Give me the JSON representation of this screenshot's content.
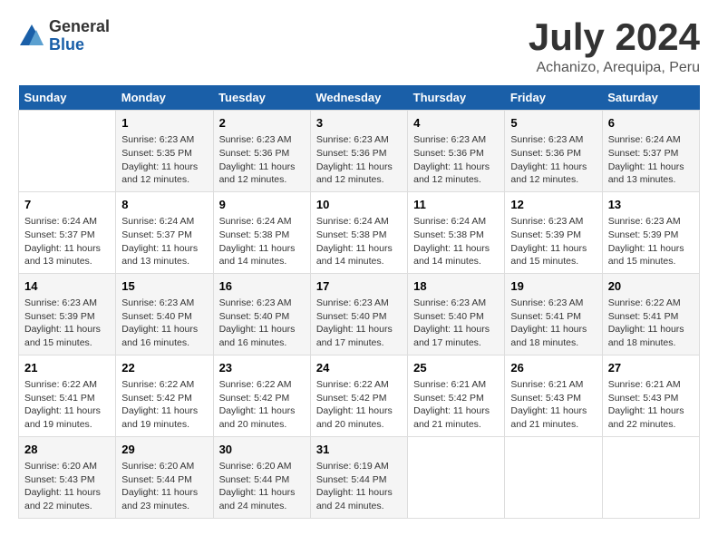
{
  "logo": {
    "general": "General",
    "blue": "Blue"
  },
  "title": "July 2024",
  "subtitle": "Achanizo, Arequipa, Peru",
  "weekdays": [
    "Sunday",
    "Monday",
    "Tuesday",
    "Wednesday",
    "Thursday",
    "Friday",
    "Saturday"
  ],
  "weeks": [
    [
      {
        "day": "",
        "text": ""
      },
      {
        "day": "1",
        "text": "Sunrise: 6:23 AM\nSunset: 5:35 PM\nDaylight: 11 hours\nand 12 minutes."
      },
      {
        "day": "2",
        "text": "Sunrise: 6:23 AM\nSunset: 5:36 PM\nDaylight: 11 hours\nand 12 minutes."
      },
      {
        "day": "3",
        "text": "Sunrise: 6:23 AM\nSunset: 5:36 PM\nDaylight: 11 hours\nand 12 minutes."
      },
      {
        "day": "4",
        "text": "Sunrise: 6:23 AM\nSunset: 5:36 PM\nDaylight: 11 hours\nand 12 minutes."
      },
      {
        "day": "5",
        "text": "Sunrise: 6:23 AM\nSunset: 5:36 PM\nDaylight: 11 hours\nand 12 minutes."
      },
      {
        "day": "6",
        "text": "Sunrise: 6:24 AM\nSunset: 5:37 PM\nDaylight: 11 hours\nand 13 minutes."
      }
    ],
    [
      {
        "day": "7",
        "text": "Sunrise: 6:24 AM\nSunset: 5:37 PM\nDaylight: 11 hours\nand 13 minutes."
      },
      {
        "day": "8",
        "text": "Sunrise: 6:24 AM\nSunset: 5:37 PM\nDaylight: 11 hours\nand 13 minutes."
      },
      {
        "day": "9",
        "text": "Sunrise: 6:24 AM\nSunset: 5:38 PM\nDaylight: 11 hours\nand 14 minutes."
      },
      {
        "day": "10",
        "text": "Sunrise: 6:24 AM\nSunset: 5:38 PM\nDaylight: 11 hours\nand 14 minutes."
      },
      {
        "day": "11",
        "text": "Sunrise: 6:24 AM\nSunset: 5:38 PM\nDaylight: 11 hours\nand 14 minutes."
      },
      {
        "day": "12",
        "text": "Sunrise: 6:23 AM\nSunset: 5:39 PM\nDaylight: 11 hours\nand 15 minutes."
      },
      {
        "day": "13",
        "text": "Sunrise: 6:23 AM\nSunset: 5:39 PM\nDaylight: 11 hours\nand 15 minutes."
      }
    ],
    [
      {
        "day": "14",
        "text": "Sunrise: 6:23 AM\nSunset: 5:39 PM\nDaylight: 11 hours\nand 15 minutes."
      },
      {
        "day": "15",
        "text": "Sunrise: 6:23 AM\nSunset: 5:40 PM\nDaylight: 11 hours\nand 16 minutes."
      },
      {
        "day": "16",
        "text": "Sunrise: 6:23 AM\nSunset: 5:40 PM\nDaylight: 11 hours\nand 16 minutes."
      },
      {
        "day": "17",
        "text": "Sunrise: 6:23 AM\nSunset: 5:40 PM\nDaylight: 11 hours\nand 17 minutes."
      },
      {
        "day": "18",
        "text": "Sunrise: 6:23 AM\nSunset: 5:40 PM\nDaylight: 11 hours\nand 17 minutes."
      },
      {
        "day": "19",
        "text": "Sunrise: 6:23 AM\nSunset: 5:41 PM\nDaylight: 11 hours\nand 18 minutes."
      },
      {
        "day": "20",
        "text": "Sunrise: 6:22 AM\nSunset: 5:41 PM\nDaylight: 11 hours\nand 18 minutes."
      }
    ],
    [
      {
        "day": "21",
        "text": "Sunrise: 6:22 AM\nSunset: 5:41 PM\nDaylight: 11 hours\nand 19 minutes."
      },
      {
        "day": "22",
        "text": "Sunrise: 6:22 AM\nSunset: 5:42 PM\nDaylight: 11 hours\nand 19 minutes."
      },
      {
        "day": "23",
        "text": "Sunrise: 6:22 AM\nSunset: 5:42 PM\nDaylight: 11 hours\nand 20 minutes."
      },
      {
        "day": "24",
        "text": "Sunrise: 6:22 AM\nSunset: 5:42 PM\nDaylight: 11 hours\nand 20 minutes."
      },
      {
        "day": "25",
        "text": "Sunrise: 6:21 AM\nSunset: 5:42 PM\nDaylight: 11 hours\nand 21 minutes."
      },
      {
        "day": "26",
        "text": "Sunrise: 6:21 AM\nSunset: 5:43 PM\nDaylight: 11 hours\nand 21 minutes."
      },
      {
        "day": "27",
        "text": "Sunrise: 6:21 AM\nSunset: 5:43 PM\nDaylight: 11 hours\nand 22 minutes."
      }
    ],
    [
      {
        "day": "28",
        "text": "Sunrise: 6:20 AM\nSunset: 5:43 PM\nDaylight: 11 hours\nand 22 minutes."
      },
      {
        "day": "29",
        "text": "Sunrise: 6:20 AM\nSunset: 5:44 PM\nDaylight: 11 hours\nand 23 minutes."
      },
      {
        "day": "30",
        "text": "Sunrise: 6:20 AM\nSunset: 5:44 PM\nDaylight: 11 hours\nand 24 minutes."
      },
      {
        "day": "31",
        "text": "Sunrise: 6:19 AM\nSunset: 5:44 PM\nDaylight: 11 hours\nand 24 minutes."
      },
      {
        "day": "",
        "text": ""
      },
      {
        "day": "",
        "text": ""
      },
      {
        "day": "",
        "text": ""
      }
    ]
  ]
}
